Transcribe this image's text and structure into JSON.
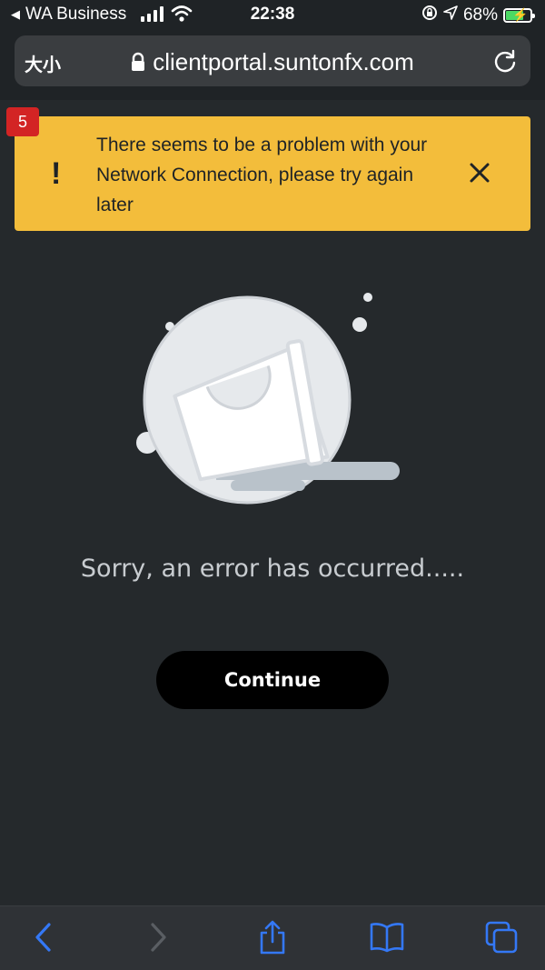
{
  "status_bar": {
    "back_app": "WA Business",
    "time": "22:38",
    "battery": "68%",
    "battery_level": 0.68
  },
  "browser": {
    "text_size_label": "大小",
    "url": "clientportal.suntonfx.com"
  },
  "notification": {
    "badge_count": "5",
    "icon": "!",
    "message": "There seems to be a problem with your Network Connection, please try again later"
  },
  "error_page": {
    "message": "Sorry, an error has occurred.....",
    "continue_label": "Continue"
  },
  "toolbar": {
    "icons": [
      "back-icon",
      "forward-icon",
      "share-icon",
      "bookmarks-icon",
      "tabs-icon"
    ]
  },
  "colors": {
    "background": "#25292c",
    "warning": "#f3bd3b",
    "badge": "#d32424",
    "accent": "#3478f6"
  }
}
